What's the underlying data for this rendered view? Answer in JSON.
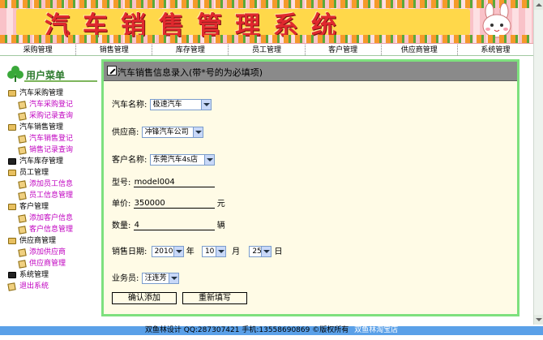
{
  "app": {
    "title": "汽车销售管理系统"
  },
  "topnav": [
    "采购管理",
    "销售管理",
    "库存管理",
    "员工管理",
    "客户管理",
    "供应商管理",
    "系统管理"
  ],
  "sidebar": {
    "heading": "用户菜单",
    "groups": [
      {
        "label": "汽车采购管理",
        "items": [
          "汽车采购登记",
          "采购记录查询"
        ]
      },
      {
        "label": "汽车销售管理",
        "items": [
          "汽车销售登记",
          "销售记录查询"
        ]
      },
      {
        "label": "汽车库存管理",
        "items": []
      },
      {
        "label": "员工管理",
        "items": [
          "添加员工信息",
          "员工信息管理"
        ]
      },
      {
        "label": "客户管理",
        "items": [
          "添加客户信息",
          "客户信息管理"
        ]
      },
      {
        "label": "供应商管理",
        "items": [
          "添加供应商",
          "供应商管理"
        ]
      },
      {
        "label": "系统管理",
        "items": []
      }
    ],
    "logout": "退出系统"
  },
  "form": {
    "title": "汽车销售信息录入(带*号的为必填项)",
    "car_label": "汽车名称:",
    "car_value": "极速汽车",
    "supplier_label": "供应商:",
    "supplier_value": "冲锋汽车公司",
    "customer_label": "客户名称:",
    "customer_value": "东莞汽车4s店",
    "model_label": "型号:",
    "model_value": "model004",
    "price_label": "单价:",
    "price_value": "350000",
    "price_unit": "元",
    "qty_label": "数量:",
    "qty_value": "4",
    "qty_unit": "辆",
    "date_label": "销售日期:",
    "year_value": "2010",
    "year_unit": "年",
    "month_value": "10",
    "month_unit": "月",
    "day_value": "25",
    "day_unit": "日",
    "staff_label": "业务员:",
    "staff_value": "汪连芳",
    "submit_label": "确认添加",
    "reset_label": "重新填写"
  },
  "footer": {
    "text": "双鱼林设计  QQ:287307421 手机:13558690869 ©版权所有",
    "link": "双鱼林淘宝店"
  },
  "colors": {
    "title_red": "#e0282e",
    "panel_border": "#7ee07e",
    "panel_bg": "#fffbe6",
    "link_magenta": "#c000c0",
    "footer_blue": "#5aa0e8"
  }
}
